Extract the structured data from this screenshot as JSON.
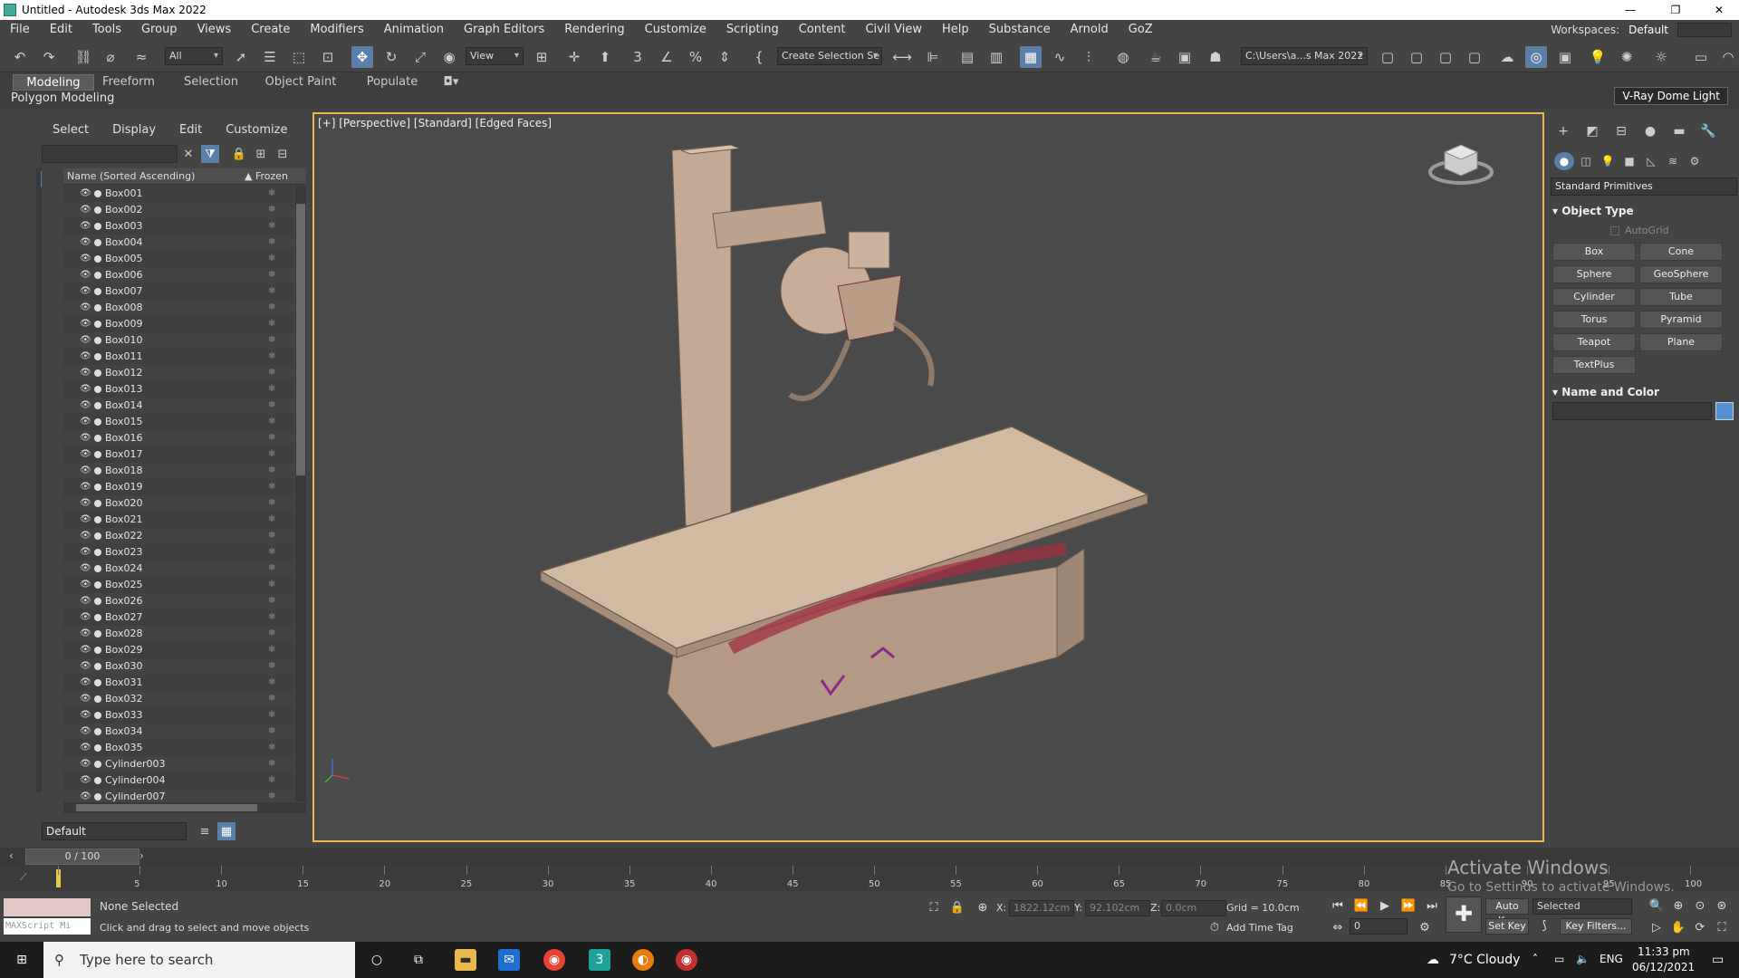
{
  "window": {
    "title": "Untitled - Autodesk 3ds Max 2022"
  },
  "menus": [
    "File",
    "Edit",
    "Tools",
    "Group",
    "Views",
    "Create",
    "Modifiers",
    "Animation",
    "Graph Editors",
    "Rendering",
    "Customize",
    "Scripting",
    "Content",
    "Civil View",
    "Help",
    "Substance",
    "Arnold",
    "GoZ"
  ],
  "workspace": {
    "label": "Workspaces:",
    "value": "Default"
  },
  "toolbar": {
    "selection_filter": "All",
    "ref_coord": "View",
    "named_selection": "Create Selection Se",
    "project_path": "C:\\Users\\a...s Max 2022"
  },
  "ribbon": {
    "tabs": [
      "Modeling",
      "Freeform",
      "Selection",
      "Object Paint",
      "Populate"
    ],
    "active_panel": "Polygon Modeling",
    "tooltip": "V-Ray Dome Light"
  },
  "explorer": {
    "menu": [
      "Select",
      "Display",
      "Edit",
      "Customize"
    ],
    "col_name": "Name (Sorted Ascending)",
    "col_frozen": "▲ Frozen",
    "items": [
      "Box001",
      "Box002",
      "Box003",
      "Box004",
      "Box005",
      "Box006",
      "Box007",
      "Box008",
      "Box009",
      "Box010",
      "Box011",
      "Box012",
      "Box013",
      "Box014",
      "Box015",
      "Box016",
      "Box017",
      "Box018",
      "Box019",
      "Box020",
      "Box021",
      "Box022",
      "Box023",
      "Box024",
      "Box025",
      "Box026",
      "Box027",
      "Box028",
      "Box029",
      "Box030",
      "Box031",
      "Box032",
      "Box033",
      "Box034",
      "Box035",
      "Cylinder003",
      "Cylinder004",
      "Cylinder007"
    ],
    "layer": "Default"
  },
  "viewport": {
    "label": "[+] [Perspective] [Standard] [Edged Faces]"
  },
  "cmdpanel": {
    "category": "Standard Primitives",
    "section_object_type": "Object Type",
    "autogrid": "AutoGrid",
    "buttons": [
      "Box",
      "Cone",
      "Sphere",
      "GeoSphere",
      "Cylinder",
      "Tube",
      "Torus",
      "Pyramid",
      "Teapot",
      "Plane",
      "TextPlus"
    ],
    "section_name_color": "Name and Color",
    "object_color": "#5790d6"
  },
  "timeline": {
    "frame_display": "0 / 100",
    "ticks": [
      "5",
      "10",
      "15",
      "20",
      "25",
      "30",
      "35",
      "40",
      "45",
      "50",
      "55",
      "60",
      "65",
      "70",
      "75",
      "80",
      "85",
      "90",
      "95",
      "100"
    ]
  },
  "watermark": {
    "line1": "Activate Windows",
    "line2": "Go to Settings to activate Windows."
  },
  "status": {
    "selection": "None Selected",
    "prompt": "Click and drag to select and move objects",
    "maxscript": "MAXScript Mi",
    "x_label": "X:",
    "x_value": "1822.12cm",
    "y_label": "Y:",
    "y_value": "92.102cm",
    "z_label": "Z:",
    "z_value": "0.0cm",
    "grid": "Grid = 10.0cm",
    "add_time_tag": "Add Time Tag",
    "auto_key": "Auto Key",
    "set_key": "Set Key",
    "key_mode": "Selected",
    "key_filters": "Key Filters...",
    "frame": "0"
  },
  "taskbar": {
    "search_placeholder": "Type here to search",
    "weather": "7°C  Cloudy",
    "lang": "ENG",
    "time": "11:33 pm",
    "date": "06/12/2021"
  }
}
